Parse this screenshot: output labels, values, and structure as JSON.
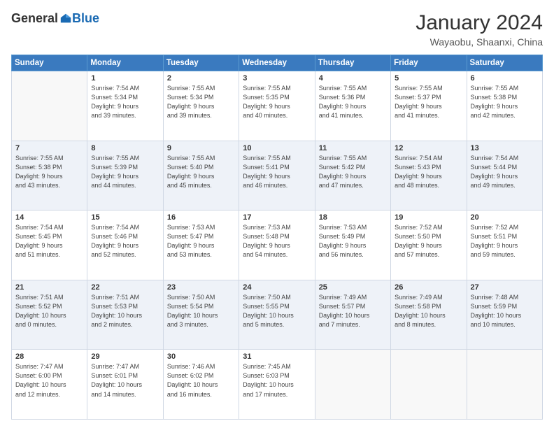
{
  "header": {
    "logo_general": "General",
    "logo_blue": "Blue",
    "month_year": "January 2024",
    "location": "Wayaobu, Shaanxi, China"
  },
  "days_of_week": [
    "Sunday",
    "Monday",
    "Tuesday",
    "Wednesday",
    "Thursday",
    "Friday",
    "Saturday"
  ],
  "weeks": [
    [
      {
        "day": "",
        "info": ""
      },
      {
        "day": "1",
        "info": "Sunrise: 7:54 AM\nSunset: 5:34 PM\nDaylight: 9 hours\nand 39 minutes."
      },
      {
        "day": "2",
        "info": "Sunrise: 7:55 AM\nSunset: 5:34 PM\nDaylight: 9 hours\nand 39 minutes."
      },
      {
        "day": "3",
        "info": "Sunrise: 7:55 AM\nSunset: 5:35 PM\nDaylight: 9 hours\nand 40 minutes."
      },
      {
        "day": "4",
        "info": "Sunrise: 7:55 AM\nSunset: 5:36 PM\nDaylight: 9 hours\nand 41 minutes."
      },
      {
        "day": "5",
        "info": "Sunrise: 7:55 AM\nSunset: 5:37 PM\nDaylight: 9 hours\nand 41 minutes."
      },
      {
        "day": "6",
        "info": "Sunrise: 7:55 AM\nSunset: 5:38 PM\nDaylight: 9 hours\nand 42 minutes."
      }
    ],
    [
      {
        "day": "7",
        "info": "Sunrise: 7:55 AM\nSunset: 5:38 PM\nDaylight: 9 hours\nand 43 minutes."
      },
      {
        "day": "8",
        "info": "Sunrise: 7:55 AM\nSunset: 5:39 PM\nDaylight: 9 hours\nand 44 minutes."
      },
      {
        "day": "9",
        "info": "Sunrise: 7:55 AM\nSunset: 5:40 PM\nDaylight: 9 hours\nand 45 minutes."
      },
      {
        "day": "10",
        "info": "Sunrise: 7:55 AM\nSunset: 5:41 PM\nDaylight: 9 hours\nand 46 minutes."
      },
      {
        "day": "11",
        "info": "Sunrise: 7:55 AM\nSunset: 5:42 PM\nDaylight: 9 hours\nand 47 minutes."
      },
      {
        "day": "12",
        "info": "Sunrise: 7:54 AM\nSunset: 5:43 PM\nDaylight: 9 hours\nand 48 minutes."
      },
      {
        "day": "13",
        "info": "Sunrise: 7:54 AM\nSunset: 5:44 PM\nDaylight: 9 hours\nand 49 minutes."
      }
    ],
    [
      {
        "day": "14",
        "info": "Sunrise: 7:54 AM\nSunset: 5:45 PM\nDaylight: 9 hours\nand 51 minutes."
      },
      {
        "day": "15",
        "info": "Sunrise: 7:54 AM\nSunset: 5:46 PM\nDaylight: 9 hours\nand 52 minutes."
      },
      {
        "day": "16",
        "info": "Sunrise: 7:53 AM\nSunset: 5:47 PM\nDaylight: 9 hours\nand 53 minutes."
      },
      {
        "day": "17",
        "info": "Sunrise: 7:53 AM\nSunset: 5:48 PM\nDaylight: 9 hours\nand 54 minutes."
      },
      {
        "day": "18",
        "info": "Sunrise: 7:53 AM\nSunset: 5:49 PM\nDaylight: 9 hours\nand 56 minutes."
      },
      {
        "day": "19",
        "info": "Sunrise: 7:52 AM\nSunset: 5:50 PM\nDaylight: 9 hours\nand 57 minutes."
      },
      {
        "day": "20",
        "info": "Sunrise: 7:52 AM\nSunset: 5:51 PM\nDaylight: 9 hours\nand 59 minutes."
      }
    ],
    [
      {
        "day": "21",
        "info": "Sunrise: 7:51 AM\nSunset: 5:52 PM\nDaylight: 10 hours\nand 0 minutes."
      },
      {
        "day": "22",
        "info": "Sunrise: 7:51 AM\nSunset: 5:53 PM\nDaylight: 10 hours\nand 2 minutes."
      },
      {
        "day": "23",
        "info": "Sunrise: 7:50 AM\nSunset: 5:54 PM\nDaylight: 10 hours\nand 3 minutes."
      },
      {
        "day": "24",
        "info": "Sunrise: 7:50 AM\nSunset: 5:55 PM\nDaylight: 10 hours\nand 5 minutes."
      },
      {
        "day": "25",
        "info": "Sunrise: 7:49 AM\nSunset: 5:57 PM\nDaylight: 10 hours\nand 7 minutes."
      },
      {
        "day": "26",
        "info": "Sunrise: 7:49 AM\nSunset: 5:58 PM\nDaylight: 10 hours\nand 8 minutes."
      },
      {
        "day": "27",
        "info": "Sunrise: 7:48 AM\nSunset: 5:59 PM\nDaylight: 10 hours\nand 10 minutes."
      }
    ],
    [
      {
        "day": "28",
        "info": "Sunrise: 7:47 AM\nSunset: 6:00 PM\nDaylight: 10 hours\nand 12 minutes."
      },
      {
        "day": "29",
        "info": "Sunrise: 7:47 AM\nSunset: 6:01 PM\nDaylight: 10 hours\nand 14 minutes."
      },
      {
        "day": "30",
        "info": "Sunrise: 7:46 AM\nSunset: 6:02 PM\nDaylight: 10 hours\nand 16 minutes."
      },
      {
        "day": "31",
        "info": "Sunrise: 7:45 AM\nSunset: 6:03 PM\nDaylight: 10 hours\nand 17 minutes."
      },
      {
        "day": "",
        "info": ""
      },
      {
        "day": "",
        "info": ""
      },
      {
        "day": "",
        "info": ""
      }
    ]
  ]
}
